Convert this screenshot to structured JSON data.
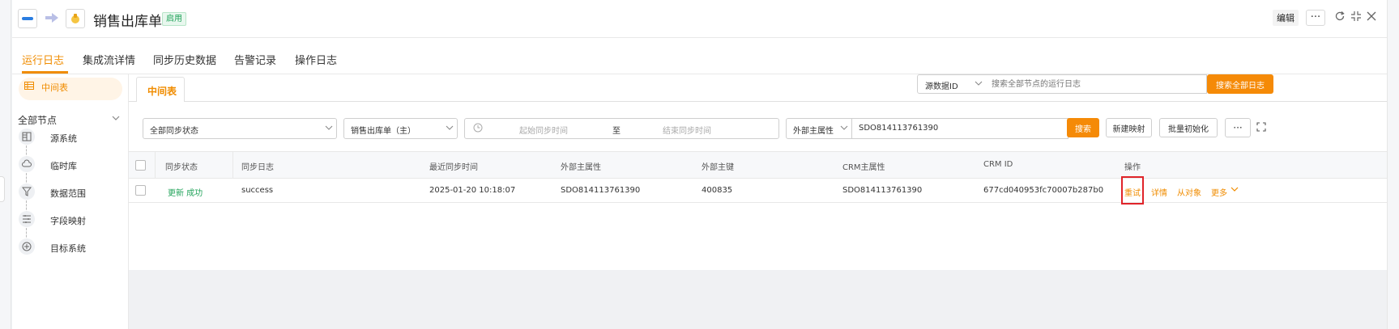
{
  "header": {
    "title": "销售出库单",
    "status_badge": "启用",
    "edit_label": "编辑",
    "more_label": "···"
  },
  "tabs": [
    {
      "label": "运行日志",
      "active": true
    },
    {
      "label": "集成流详情",
      "active": false
    },
    {
      "label": "同步历史数据",
      "active": false
    },
    {
      "label": "告警记录",
      "active": false
    },
    {
      "label": "操作日志",
      "active": false
    }
  ],
  "sidebar": {
    "active_item": "中间表",
    "group_label": "全部节点",
    "nodes": [
      {
        "label": "源系统",
        "icon": "database-icon"
      },
      {
        "label": "临时库",
        "icon": "cloud-storage-icon"
      },
      {
        "label": "数据范围",
        "icon": "filter-icon"
      },
      {
        "label": "字段映射",
        "icon": "mapping-icon"
      },
      {
        "label": "目标系统",
        "icon": "target-icon"
      }
    ]
  },
  "content": {
    "active_tab": "中间表",
    "source_select": "源数据ID",
    "search_placeholder": "搜索全部节点的运行日志",
    "search_all_button": "搜索全部日志"
  },
  "filters": {
    "sync_status": "全部同步状态",
    "object": "销售出库单（主）",
    "start_placeholder": "起始同步时间",
    "range_sep": "至",
    "end_placeholder": "结束同步时间",
    "field_select": "外部主属性",
    "field_value": "SDO814113761390",
    "search_button": "搜索",
    "create_mapping_button": "新建映射",
    "batch_init_button": "批量初始化",
    "more_button": "···"
  },
  "table": {
    "columns": [
      "同步状态",
      "同步日志",
      "最近同步时间",
      "外部主属性",
      "外部主键",
      "CRM主属性",
      "CRM ID",
      "操作"
    ],
    "rows": [
      {
        "status": "更新 成功",
        "log": "success",
        "last_sync": "2025-01-20 10:18:07",
        "ext_attr": "SDO814113761390",
        "ext_key": "400835",
        "crm_attr": "SDO814113761390",
        "crm_id": "677cd040953fc70007b287b0",
        "actions": {
          "retry": "重试",
          "detail": "详情",
          "sub_object": "从对象",
          "more": "更多"
        }
      }
    ]
  },
  "colors": {
    "accent": "#f08c00",
    "success": "#21a35a",
    "highlight_border": "#e0242a"
  }
}
